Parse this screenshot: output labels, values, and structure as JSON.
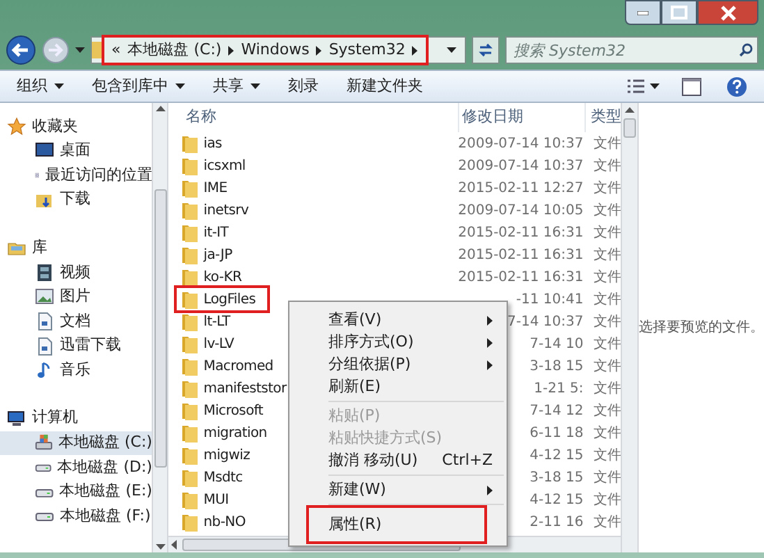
{
  "address_bar": {
    "overflow": "«",
    "crumbs": [
      "本地磁盘 (C:)",
      "Windows",
      "System32"
    ],
    "highlighted": true
  },
  "search": {
    "placeholder": "搜索 System32"
  },
  "toolbar": [
    {
      "label": "组织",
      "dropdown": true
    },
    {
      "label": "包含到库中",
      "dropdown": true
    },
    {
      "label": "共享",
      "dropdown": true
    },
    {
      "label": "刻录",
      "dropdown": false
    },
    {
      "label": "新建文件夹",
      "dropdown": false
    }
  ],
  "sidebar": [
    {
      "kind": "group",
      "label": "收藏夹",
      "selected": false
    },
    {
      "kind": "item",
      "label": "桌面",
      "selected": false
    },
    {
      "kind": "item",
      "label": "最近访问的位置",
      "selected": false
    },
    {
      "kind": "item",
      "label": "下载",
      "selected": false
    },
    {
      "kind": "gap"
    },
    {
      "kind": "group",
      "label": "库",
      "selected": false
    },
    {
      "kind": "item",
      "label": "视频",
      "selected": false
    },
    {
      "kind": "item",
      "label": "图片",
      "selected": false
    },
    {
      "kind": "item",
      "label": "文档",
      "selected": false
    },
    {
      "kind": "item",
      "label": "迅雷下载",
      "selected": false
    },
    {
      "kind": "item",
      "label": "音乐",
      "selected": false
    },
    {
      "kind": "gap"
    },
    {
      "kind": "group",
      "label": "计算机",
      "selected": false
    },
    {
      "kind": "item",
      "label": "本地磁盘 (C:)",
      "selected": true
    },
    {
      "kind": "item",
      "label": "本地磁盘 (D:)",
      "selected": false
    },
    {
      "kind": "item",
      "label": "本地磁盘 (E:)",
      "selected": false
    },
    {
      "kind": "item",
      "label": "本地磁盘 (F:)",
      "selected": false
    }
  ],
  "file_list": {
    "columns": [
      "名称",
      "修改日期",
      "类型"
    ],
    "rows": [
      {
        "name": "ias",
        "date": "2009-07-14 10:37",
        "type": "文件",
        "highlighted": false
      },
      {
        "name": "icsxml",
        "date": "2009-07-14 10:37",
        "type": "文件",
        "highlighted": false
      },
      {
        "name": "IME",
        "date": "2015-02-11 12:27",
        "type": "文件",
        "highlighted": false
      },
      {
        "name": "inetsrv",
        "date": "2009-07-14 10:05",
        "type": "文件",
        "highlighted": false
      },
      {
        "name": "it-IT",
        "date": "2015-02-11 16:31",
        "type": "文件",
        "highlighted": false
      },
      {
        "name": "ja-JP",
        "date": "2015-02-11 16:31",
        "type": "文件",
        "highlighted": false
      },
      {
        "name": "ko-KR",
        "date": "2015-02-11 16:31",
        "type": "文件",
        "highlighted": false
      },
      {
        "name": "LogFiles",
        "date": "-11 10:41",
        "type": "文件",
        "highlighted": true
      },
      {
        "name": "lt-LT",
        "date": "7-14 10:37",
        "type": "文件",
        "highlighted": false
      },
      {
        "name": "lv-LV",
        "date": "7-14 10",
        "type": "文件",
        "highlighted": false
      },
      {
        "name": "Macromed",
        "date": "3-18 15",
        "type": "文件",
        "highlighted": false
      },
      {
        "name": "manifeststor",
        "date": "1-21 5:",
        "type": "文件",
        "highlighted": false
      },
      {
        "name": "Microsoft",
        "date": "7-14 12",
        "type": "文件",
        "highlighted": false
      },
      {
        "name": "migration",
        "date": "6-11 18",
        "type": "文件",
        "highlighted": false
      },
      {
        "name": "migwiz",
        "date": "4-12 15",
        "type": "文件",
        "highlighted": false
      },
      {
        "name": "Msdtc",
        "date": "3-18 15",
        "type": "文件",
        "highlighted": false
      },
      {
        "name": "MUI",
        "date": "4-12 15",
        "type": "文件",
        "highlighted": false
      },
      {
        "name": "nb-NO",
        "date": "2-11 16",
        "type": "文件",
        "highlighted": false
      }
    ]
  },
  "preview": {
    "message": "选择要预览的文件。"
  },
  "context_menu": [
    {
      "kind": "item",
      "label": "查看(V)",
      "submenu": true,
      "disabled": false,
      "highlighted": false
    },
    {
      "kind": "item",
      "label": "排序方式(O)",
      "submenu": true,
      "disabled": false,
      "highlighted": false
    },
    {
      "kind": "item",
      "label": "分组依据(P)",
      "submenu": true,
      "disabled": false,
      "highlighted": false
    },
    {
      "kind": "item",
      "label": "刷新(E)",
      "submenu": false,
      "disabled": false,
      "highlighted": false
    },
    {
      "kind": "separator"
    },
    {
      "kind": "item",
      "label": "粘贴(P)",
      "submenu": false,
      "disabled": true,
      "highlighted": false
    },
    {
      "kind": "item",
      "label": "粘贴快捷方式(S)",
      "submenu": false,
      "disabled": true,
      "highlighted": false
    },
    {
      "kind": "item",
      "label": "撤消 移动(U)",
      "shortcut": "Ctrl+Z",
      "submenu": false,
      "disabled": false,
      "highlighted": false
    },
    {
      "kind": "separator"
    },
    {
      "kind": "item",
      "label": "新建(W)",
      "submenu": true,
      "disabled": false,
      "highlighted": false
    },
    {
      "kind": "separator"
    },
    {
      "kind": "item",
      "label": "属性(R)",
      "submenu": false,
      "disabled": false,
      "highlighted": true
    }
  ]
}
